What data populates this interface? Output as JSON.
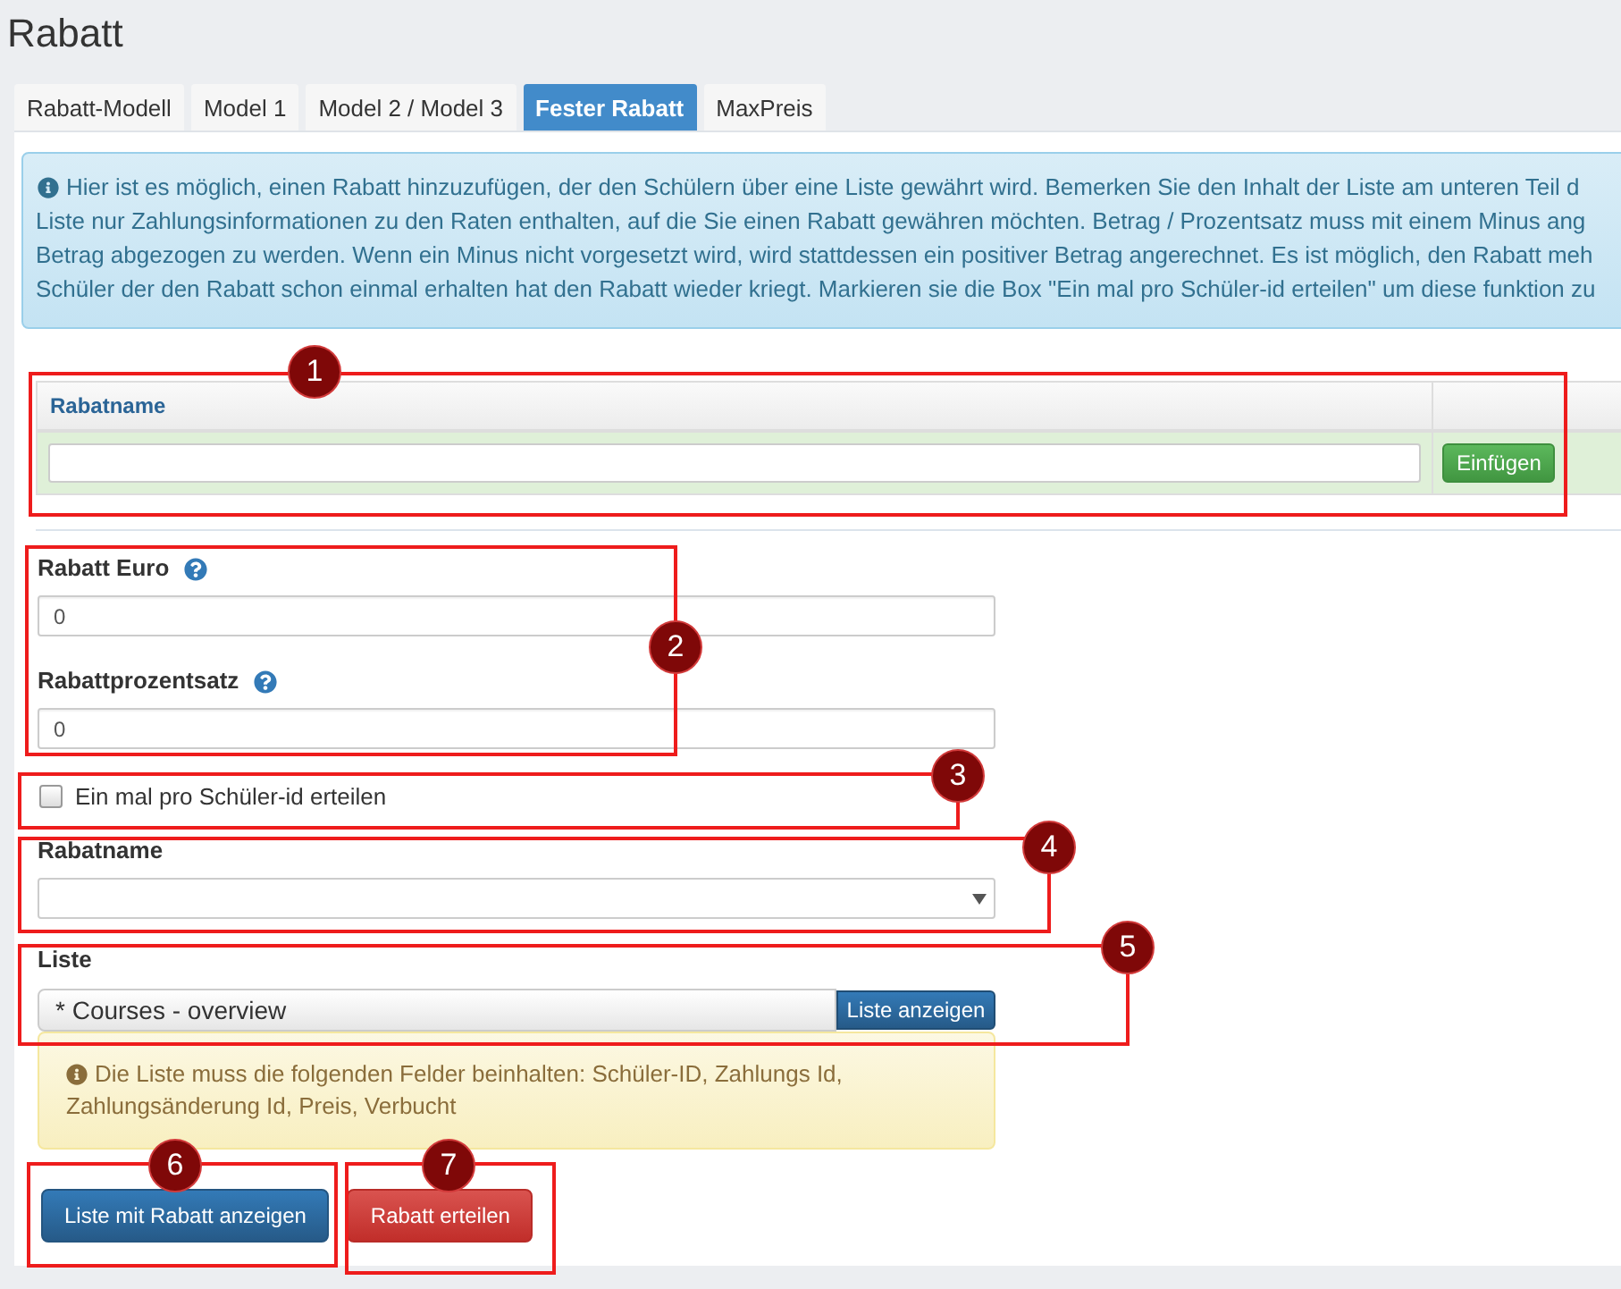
{
  "page": {
    "title": "Rabatt"
  },
  "tabs": [
    {
      "label": "Rabatt-Modell",
      "selected": false
    },
    {
      "label": "Model 1",
      "selected": false
    },
    {
      "label": "Model 2 / Model 3",
      "selected": false
    },
    {
      "label": "Fester Rabatt",
      "selected": true
    },
    {
      "label": "MaxPreis",
      "selected": false
    }
  ],
  "info": {
    "lines": [
      "Hier ist es möglich, einen Rabatt hinzuzufügen, der den Schülern über eine Liste gewährt wird. Bemerken Sie den Inhalt der Liste am unteren Teil d",
      "Liste nur Zahlungsinformationen zu den Raten enthalten, auf die Sie einen Rabatt gewähren möchten. Betrag / Prozentsatz muss mit einem Minus ang",
      "Betrag abgezogen zu werden. Wenn ein Minus nicht vorgesetzt wird, wird stattdessen ein positiver Betrag angerechnet. Es ist möglich, den Rabatt meh",
      "Schüler der den Rabatt schon einmal erhalten hat den Rabatt wieder kriegt. Markieren sie die Box \"Ein mal pro Schüler-id erteilen\" um diese funktion zu"
    ]
  },
  "table": {
    "columns": [
      "Rabatname"
    ],
    "add_button": "Einfügen"
  },
  "form": {
    "fields": [
      {
        "kind": "number",
        "label": "Rabatt Euro",
        "help": true,
        "value": "0"
      },
      {
        "kind": "number",
        "label": "Rabattprozentsatz",
        "help": true,
        "value": "0"
      },
      {
        "kind": "checkbox",
        "label": "Ein mal pro Schüler-id erteilen",
        "checked": false
      },
      {
        "kind": "select",
        "label": "Rabatname"
      },
      {
        "kind": "list",
        "label": "Liste",
        "value": "* Courses - overview",
        "button": "Liste anzeigen"
      }
    ]
  },
  "note": {
    "lines": [
      "Die Liste muss die folgenden Felder beinhalten: Schüler-ID, Zahlungs Id,",
      "Zahlungsänderung Id, Preis, Verbucht"
    ]
  },
  "actions": [
    {
      "label": "Liste mit Rabatt anzeigen",
      "kind": "primary"
    },
    {
      "label": "Rabatt erteilen",
      "kind": "danger"
    }
  ],
  "callouts": [
    {
      "number": "1"
    },
    {
      "number": "2"
    },
    {
      "number": "3"
    },
    {
      "number": "4"
    },
    {
      "number": "5"
    },
    {
      "number": "6"
    },
    {
      "number": "7"
    }
  ]
}
